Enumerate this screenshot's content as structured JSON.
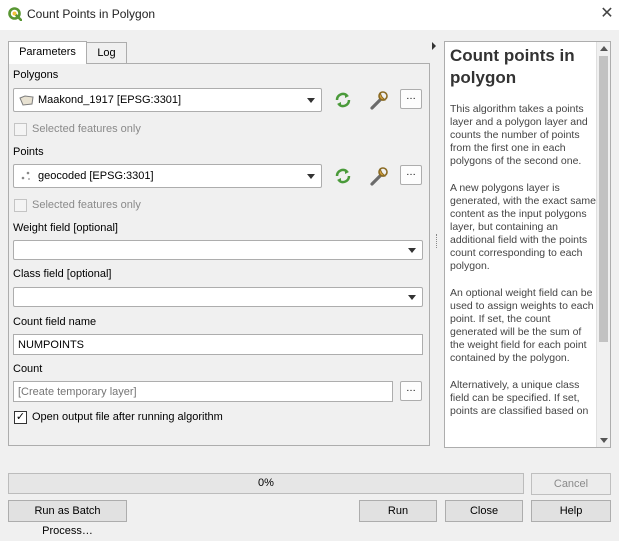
{
  "window": {
    "title": "Count Points in Polygon",
    "close_glyph": "✕",
    "accent": "#589632"
  },
  "tabs": [
    {
      "label": "Parameters",
      "active": true
    },
    {
      "label": "Log",
      "active": false
    }
  ],
  "form": {
    "polygons": {
      "label": "Polygons",
      "value": "Maakond_1917 [EPSG:3301]",
      "icon": "polygon-layer-icon",
      "selected_only_label": "Selected features only",
      "selected_only_checked": false
    },
    "points": {
      "label": "Points",
      "value": "geocoded [EPSG:3301]",
      "icon": "point-layer-icon",
      "selected_only_label": "Selected features only",
      "selected_only_checked": false
    },
    "weight_field": {
      "label": "Weight field [optional]",
      "value": ""
    },
    "class_field": {
      "label": "Class field [optional]",
      "value": ""
    },
    "count_field_name": {
      "label": "Count field name",
      "value": "NUMPOINTS"
    },
    "count": {
      "label": "Count",
      "placeholder": "[Create temporary layer]"
    },
    "open_output": {
      "label": "Open output file after running algorithm",
      "checked": true
    },
    "ellipsis": "…"
  },
  "help": {
    "title": "Count points in polygon",
    "paragraphs": [
      "This algorithm takes a points layer and a polygon layer and counts the number of points from the first one in each polygons of the second one.",
      "A new polygons layer is generated, with the exact same content as the input polygons layer, but containing an additional field with the points count corresponding to each polygon.",
      "An optional weight field can be used to assign weights to each point. If set, the count generated will be the sum of the weight field for each point contained by the polygon.",
      "Alternatively, a unique class field can be specified. If set, points are classified based on"
    ]
  },
  "progress": {
    "value": 0,
    "text": "0%"
  },
  "buttons": {
    "cancel": "Cancel",
    "batch": "Run as Batch Process…",
    "run": "Run",
    "close": "Close",
    "help": "Help"
  }
}
